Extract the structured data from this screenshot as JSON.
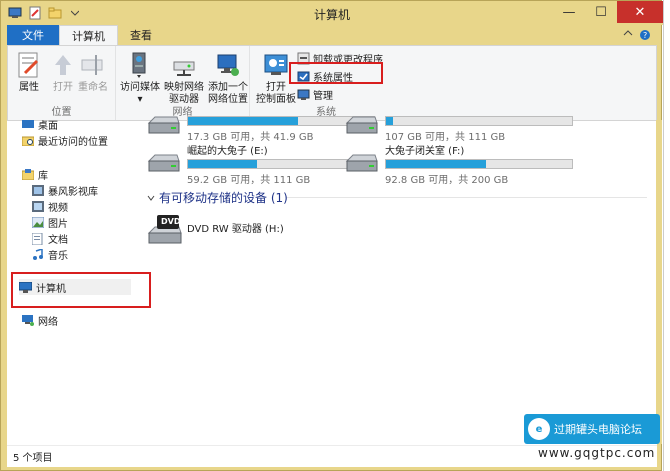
{
  "window": {
    "title": "计算机",
    "minimize": "—",
    "maximize": "☐",
    "close": "✕"
  },
  "ribbon_tabs": {
    "file": "文件",
    "computer": "计算机",
    "view": "查看"
  },
  "ribbon": {
    "location_group": {
      "label": "位置",
      "properties": "属性",
      "open": "打开",
      "rename": "重命名"
    },
    "network_group": {
      "label": "网络",
      "access_media": "访问媒体",
      "map_drive_line1": "映射网络",
      "map_drive_line2": "驱动器",
      "add_location_line1": "添加一个",
      "add_location_line2": "网络位置"
    },
    "system_group": {
      "label": "系统",
      "control_panel_line1": "打开",
      "control_panel_line2": "控制面板",
      "uninstall": "卸载或更改程序",
      "system_properties": "系统属性",
      "manage": "管理"
    }
  },
  "nav": {
    "desktop": "桌面",
    "recent": "最近访问的位置",
    "libraries": "库",
    "storm": "暴风影视库",
    "videos": "视频",
    "pictures": "图片",
    "documents": "文档",
    "music": "音乐",
    "computer": "计算机",
    "network": "网络"
  },
  "drives": [
    {
      "name": "",
      "size": "17.3 GB 可用，共 41.9 GB",
      "used_fraction": 0.59
    },
    {
      "name": "",
      "size": "107 GB 可用，共 111 GB",
      "used_fraction": 0.04
    },
    {
      "name": "崛起的大兔子 (E:)",
      "size": "59.2 GB 可用，共 111 GB",
      "used_fraction": 0.37
    },
    {
      "name": "大兔子闭关室 (F:)",
      "size": "92.8 GB 可用，共 200 GB",
      "used_fraction": 0.54
    }
  ],
  "removable_section": "有可移动存储的设备 (1)",
  "dvd": {
    "name": "DVD RW 驱动器 (H:)",
    "label": "DVD"
  },
  "status": "5 个项目",
  "watermark": {
    "text": "过期罐头电脑论坛",
    "url": "www.gqgtpc.com",
    "logo": "e"
  },
  "colors": {
    "frame": "#e8d68a",
    "file_tab": "#1f6fc5",
    "drive_fill": "#26a0da",
    "highlight": "#d81e1e"
  }
}
